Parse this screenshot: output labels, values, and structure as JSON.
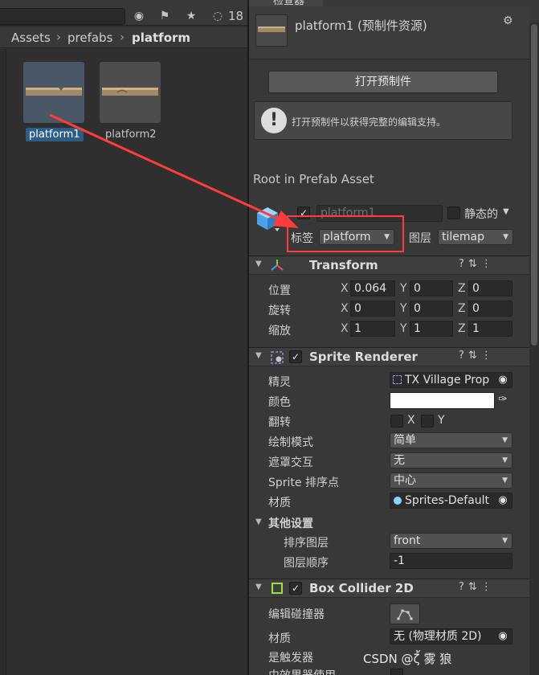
{
  "project": {
    "hidden_count": "18",
    "breadcrumb": [
      "Assets",
      "prefabs",
      "platform"
    ],
    "assets": [
      {
        "name": "platform1",
        "selected": true
      },
      {
        "name": "platform2",
        "selected": false
      }
    ]
  },
  "inspector": {
    "tab_label": "检查器",
    "prefab_title": "platform1 (预制件资源)",
    "open_prefab_button": "打开预制件",
    "help_text": "打开预制件以获得完整的编辑支持。",
    "root_label": "Root in Prefab Asset",
    "gameobject": {
      "name": "platform1",
      "active": true,
      "static_label": "静态的",
      "tag_label": "标签",
      "tag_value": "platform",
      "layer_label": "图层",
      "layer_value": "tilemap"
    },
    "transform": {
      "title": "Transform",
      "position_label": "位置",
      "rotation_label": "旋转",
      "scale_label": "缩放",
      "position": {
        "x": "0.064",
        "y": "0",
        "z": "0"
      },
      "rotation": {
        "x": "0",
        "y": "0",
        "z": "0"
      },
      "scale": {
        "x": "1",
        "y": "1",
        "z": "1"
      }
    },
    "sprite_renderer": {
      "title": "Sprite Renderer",
      "sprite_label": "精灵",
      "sprite_value": "TX Village Prop",
      "color_label": "颜色",
      "color_value": "#ffffff",
      "flip_label": "翻转",
      "flip_x": "X",
      "flip_y": "Y",
      "draw_mode_label": "绘制模式",
      "draw_mode_value": "简单",
      "mask_label": "遮罩交互",
      "mask_value": "无",
      "sort_point_label": "Sprite 排序点",
      "sort_point_value": "中心",
      "material_label": "材质",
      "material_value": "Sprites-Default",
      "other_settings": "其他设置",
      "sorting_layer_label": "排序图层",
      "sorting_layer_value": "front",
      "order_label": "图层顺序",
      "order_value": "-1"
    },
    "box_collider": {
      "title": "Box Collider 2D",
      "edit_label": "编辑碰撞器",
      "material_label": "材质",
      "material_value": "无 (物理材质 2D)",
      "trigger_label": "是触发器",
      "effector_label": "由效果器使用"
    }
  },
  "watermark": "CSDN @ζ้ 雾 狼",
  "colors": {
    "highlight": "#ff3b3b",
    "arrow": "#ff3b3b",
    "selection": "#2c5d87",
    "collider_icon": "#9be03c"
  }
}
